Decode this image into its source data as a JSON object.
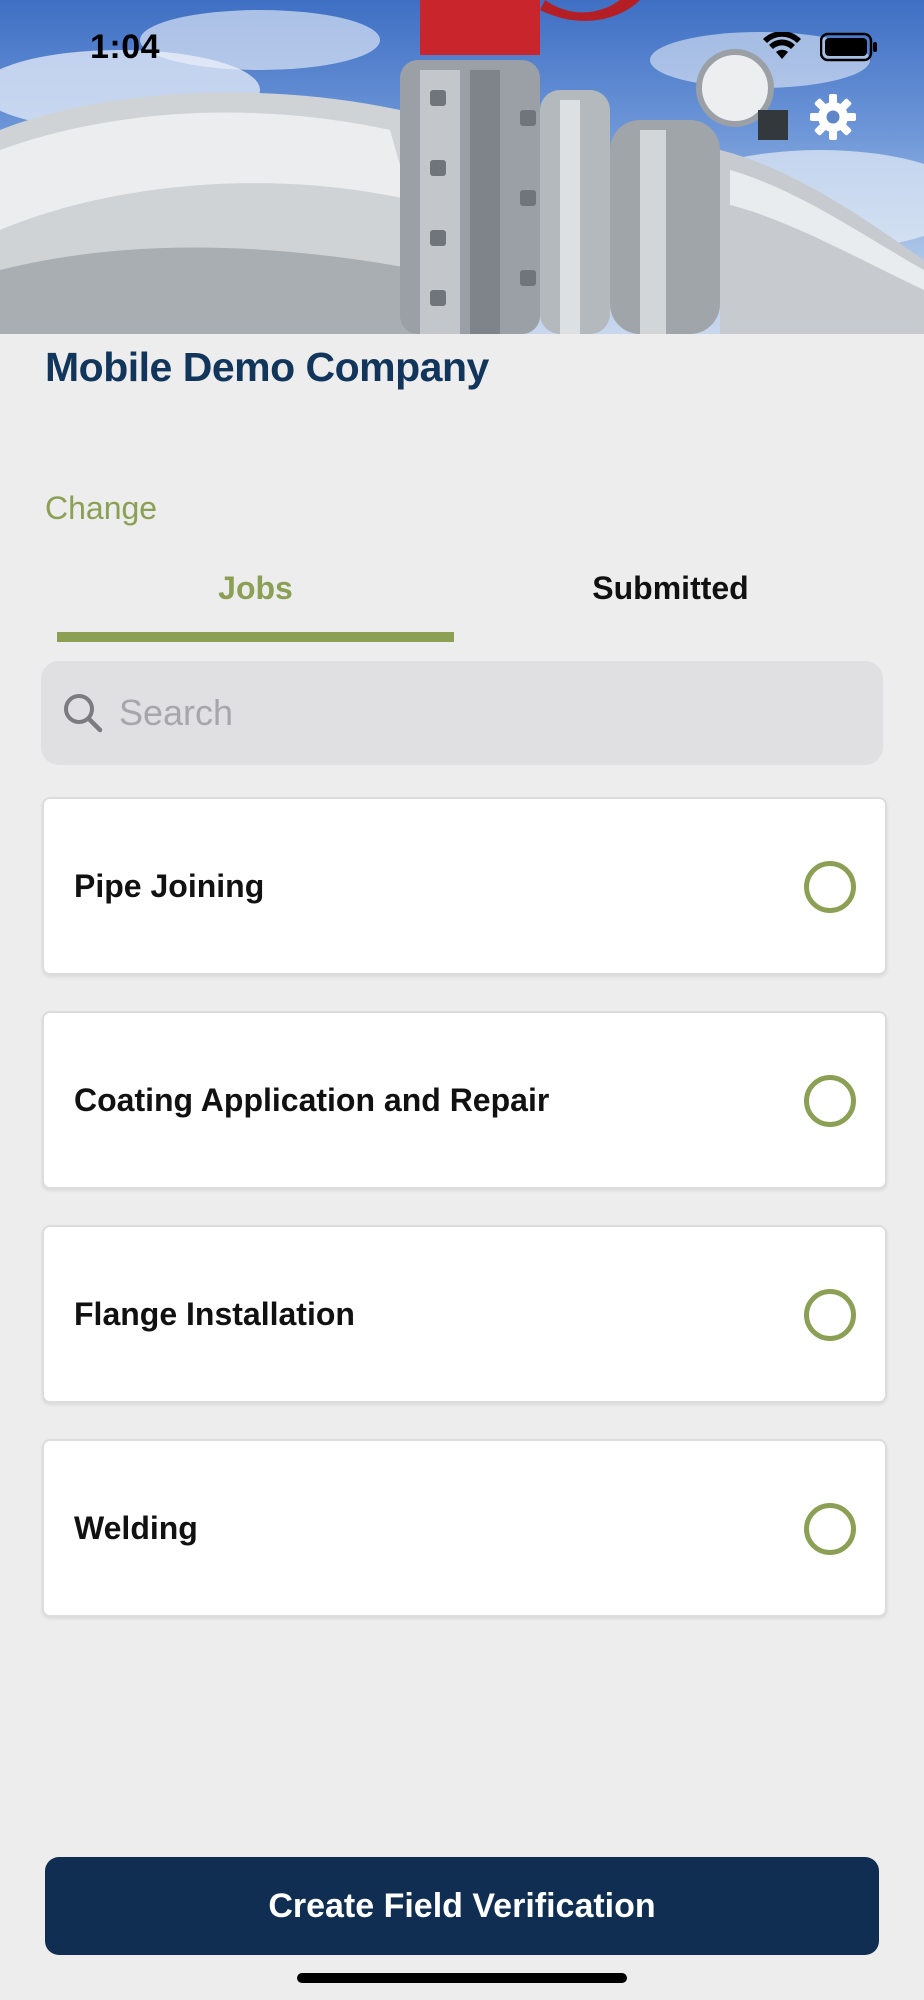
{
  "status_bar": {
    "time": "1:04"
  },
  "header": {
    "image_subject": "industrial pipeline with flange and valve",
    "settings_icon": "gear-icon"
  },
  "company": {
    "name": "Mobile Demo Company",
    "change_label": "Change"
  },
  "tabs": [
    {
      "label": "Jobs",
      "selected": true
    },
    {
      "label": "Submitted",
      "selected": false
    }
  ],
  "search": {
    "placeholder": "Search"
  },
  "jobs": [
    {
      "label": "Pipe Joining"
    },
    {
      "label": "Coating Application and Repair"
    },
    {
      "label": "Flange Installation"
    },
    {
      "label": "Welding"
    }
  ],
  "footer": {
    "primary_button": "Create Field Verification"
  },
  "colors": {
    "accent_green": "#8ba055",
    "navy": "#0f2e52",
    "title_blue": "#12355b",
    "background": "#ededed"
  }
}
